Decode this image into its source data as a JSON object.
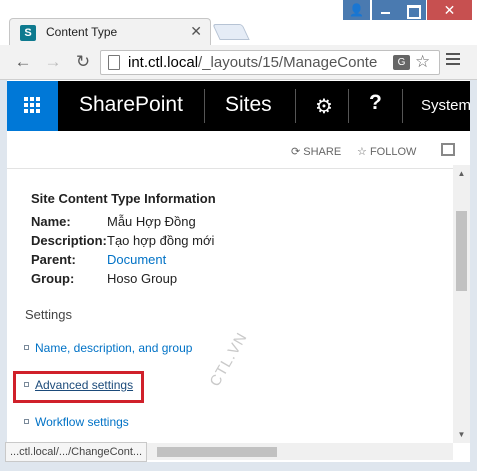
{
  "browser": {
    "tab_title": "Content Type",
    "tab_favicon_letter": "S",
    "url_host": "int.ctl.local",
    "url_path": "/_layouts/15/ManageConte",
    "status_url": "...ctl.local/.../ChangeCont...",
    "translate_label": "G"
  },
  "suitebar": {
    "brand": "SharePoint",
    "sites": "Sites",
    "help": "?",
    "system": "System",
    "accent_color": "#0078d7"
  },
  "actions": {
    "share": "SHARE",
    "follow": "FOLLOW"
  },
  "content_type_info": {
    "heading": "Site Content Type Information",
    "rows": [
      {
        "label": "Name:",
        "value": "Mẫu Hợp Đồng"
      },
      {
        "label": "Description:",
        "value": "Tạo hợp đồng mới"
      },
      {
        "label": "Parent:",
        "value": "Document"
      },
      {
        "label": "Group:",
        "value": "Hoso Group"
      }
    ]
  },
  "settings": {
    "heading": "Settings",
    "items": [
      {
        "label": "Name, description, and group"
      },
      {
        "label": "Advanced settings"
      },
      {
        "label": "Workflow settings"
      }
    ]
  },
  "watermark": "CTL.VN",
  "highlight_color": "#d0202a"
}
